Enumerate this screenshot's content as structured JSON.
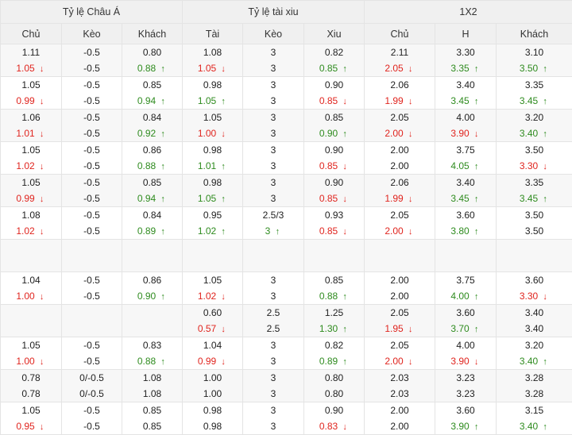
{
  "header": {
    "groups": [
      "Tỷ lệ Châu Á",
      "Tỷ lệ tài xiu",
      "1X2"
    ],
    "columns": [
      "Chủ",
      "Kèo",
      "Khách",
      "Tài",
      "Kèo",
      "Xiu",
      "Chủ",
      "H",
      "Khách"
    ]
  },
  "colors": {
    "up": "#2e8b1e",
    "down": "#e0241e",
    "header_bg": "#f0f0f0",
    "alt_bg": "#f7f7f7"
  },
  "rows": [
    [
      [
        {
          "v": "1.11"
        },
        {
          "v": "1.05",
          "d": "down"
        }
      ],
      [
        {
          "v": "-0.5"
        },
        {
          "v": "-0.5"
        }
      ],
      [
        {
          "v": "0.80"
        },
        {
          "v": "0.88",
          "d": "up"
        }
      ],
      [
        {
          "v": "1.08"
        },
        {
          "v": "1.05",
          "d": "down"
        }
      ],
      [
        {
          "v": "3"
        },
        {
          "v": "3"
        }
      ],
      [
        {
          "v": "0.82"
        },
        {
          "v": "0.85",
          "d": "up"
        }
      ],
      [
        {
          "v": "2.11"
        },
        {
          "v": "2.05",
          "d": "down"
        }
      ],
      [
        {
          "v": "3.30"
        },
        {
          "v": "3.35",
          "d": "up"
        }
      ],
      [
        {
          "v": "3.10"
        },
        {
          "v": "3.50",
          "d": "up"
        }
      ]
    ],
    [
      [
        {
          "v": "1.05"
        },
        {
          "v": "0.99",
          "d": "down"
        }
      ],
      [
        {
          "v": "-0.5"
        },
        {
          "v": "-0.5"
        }
      ],
      [
        {
          "v": "0.85"
        },
        {
          "v": "0.94",
          "d": "up"
        }
      ],
      [
        {
          "v": "0.98"
        },
        {
          "v": "1.05",
          "d": "up"
        }
      ],
      [
        {
          "v": "3"
        },
        {
          "v": "3"
        }
      ],
      [
        {
          "v": "0.90"
        },
        {
          "v": "0.85",
          "d": "down"
        }
      ],
      [
        {
          "v": "2.06"
        },
        {
          "v": "1.99",
          "d": "down"
        }
      ],
      [
        {
          "v": "3.40"
        },
        {
          "v": "3.45",
          "d": "up"
        }
      ],
      [
        {
          "v": "3.35"
        },
        {
          "v": "3.45",
          "d": "up"
        }
      ]
    ],
    [
      [
        {
          "v": "1.06"
        },
        {
          "v": "1.01",
          "d": "down"
        }
      ],
      [
        {
          "v": "-0.5"
        },
        {
          "v": "-0.5"
        }
      ],
      [
        {
          "v": "0.84"
        },
        {
          "v": "0.92",
          "d": "up"
        }
      ],
      [
        {
          "v": "1.05"
        },
        {
          "v": "1.00",
          "d": "down"
        }
      ],
      [
        {
          "v": "3"
        },
        {
          "v": "3"
        }
      ],
      [
        {
          "v": "0.85"
        },
        {
          "v": "0.90",
          "d": "up"
        }
      ],
      [
        {
          "v": "2.05"
        },
        {
          "v": "2.00",
          "d": "down"
        }
      ],
      [
        {
          "v": "4.00"
        },
        {
          "v": "3.90",
          "d": "down"
        }
      ],
      [
        {
          "v": "3.20"
        },
        {
          "v": "3.40",
          "d": "up"
        }
      ]
    ],
    [
      [
        {
          "v": "1.05"
        },
        {
          "v": "1.02",
          "d": "down"
        }
      ],
      [
        {
          "v": "-0.5"
        },
        {
          "v": "-0.5"
        }
      ],
      [
        {
          "v": "0.86"
        },
        {
          "v": "0.88",
          "d": "up"
        }
      ],
      [
        {
          "v": "0.98"
        },
        {
          "v": "1.01",
          "d": "up"
        }
      ],
      [
        {
          "v": "3"
        },
        {
          "v": "3"
        }
      ],
      [
        {
          "v": "0.90"
        },
        {
          "v": "0.85",
          "d": "down"
        }
      ],
      [
        {
          "v": "2.00"
        },
        {
          "v": "2.00"
        }
      ],
      [
        {
          "v": "3.75"
        },
        {
          "v": "4.05",
          "d": "up"
        }
      ],
      [
        {
          "v": "3.50"
        },
        {
          "v": "3.30",
          "d": "down"
        }
      ]
    ],
    [
      [
        {
          "v": "1.05"
        },
        {
          "v": "0.99",
          "d": "down"
        }
      ],
      [
        {
          "v": "-0.5"
        },
        {
          "v": "-0.5"
        }
      ],
      [
        {
          "v": "0.85"
        },
        {
          "v": "0.94",
          "d": "up"
        }
      ],
      [
        {
          "v": "0.98"
        },
        {
          "v": "1.05",
          "d": "up"
        }
      ],
      [
        {
          "v": "3"
        },
        {
          "v": "3"
        }
      ],
      [
        {
          "v": "0.90"
        },
        {
          "v": "0.85",
          "d": "down"
        }
      ],
      [
        {
          "v": "2.06"
        },
        {
          "v": "1.99",
          "d": "down"
        }
      ],
      [
        {
          "v": "3.40"
        },
        {
          "v": "3.45",
          "d": "up"
        }
      ],
      [
        {
          "v": "3.35"
        },
        {
          "v": "3.45",
          "d": "up"
        }
      ]
    ],
    [
      [
        {
          "v": "1.08"
        },
        {
          "v": "1.02",
          "d": "down"
        }
      ],
      [
        {
          "v": "-0.5"
        },
        {
          "v": "-0.5"
        }
      ],
      [
        {
          "v": "0.84"
        },
        {
          "v": "0.89",
          "d": "up"
        }
      ],
      [
        {
          "v": "0.95"
        },
        {
          "v": "1.02",
          "d": "up"
        }
      ],
      [
        {
          "v": "2.5/3"
        },
        {
          "v": "3",
          "d": "up"
        }
      ],
      [
        {
          "v": "0.93"
        },
        {
          "v": "0.85",
          "d": "down"
        }
      ],
      [
        {
          "v": "2.05"
        },
        {
          "v": "2.00",
          "d": "down"
        }
      ],
      [
        {
          "v": "3.60"
        },
        {
          "v": "3.80",
          "d": "up"
        }
      ],
      [
        {
          "v": "3.50"
        },
        {
          "v": "3.50"
        }
      ]
    ],
    [
      [],
      [],
      [],
      [],
      [],
      [],
      [],
      [],
      []
    ],
    [
      [
        {
          "v": "1.04"
        },
        {
          "v": "1.00",
          "d": "down"
        }
      ],
      [
        {
          "v": "-0.5"
        },
        {
          "v": "-0.5"
        }
      ],
      [
        {
          "v": "0.86"
        },
        {
          "v": "0.90",
          "d": "up"
        }
      ],
      [
        {
          "v": "1.05"
        },
        {
          "v": "1.02",
          "d": "down"
        }
      ],
      [
        {
          "v": "3"
        },
        {
          "v": "3"
        }
      ],
      [
        {
          "v": "0.85"
        },
        {
          "v": "0.88",
          "d": "up"
        }
      ],
      [
        {
          "v": "2.00"
        },
        {
          "v": "2.00"
        }
      ],
      [
        {
          "v": "3.75"
        },
        {
          "v": "4.00",
          "d": "up"
        }
      ],
      [
        {
          "v": "3.60"
        },
        {
          "v": "3.30",
          "d": "down"
        }
      ]
    ],
    [
      [],
      [],
      [],
      [
        {
          "v": "0.60"
        },
        {
          "v": "0.57",
          "d": "down"
        }
      ],
      [
        {
          "v": "2.5"
        },
        {
          "v": "2.5"
        }
      ],
      [
        {
          "v": "1.25"
        },
        {
          "v": "1.30",
          "d": "up"
        }
      ],
      [
        {
          "v": "2.05"
        },
        {
          "v": "1.95",
          "d": "down"
        }
      ],
      [
        {
          "v": "3.60"
        },
        {
          "v": "3.70",
          "d": "up"
        }
      ],
      [
        {
          "v": "3.40"
        },
        {
          "v": "3.40"
        }
      ]
    ],
    [
      [
        {
          "v": "1.05"
        },
        {
          "v": "1.00",
          "d": "down"
        }
      ],
      [
        {
          "v": "-0.5"
        },
        {
          "v": "-0.5"
        }
      ],
      [
        {
          "v": "0.83"
        },
        {
          "v": "0.88",
          "d": "up"
        }
      ],
      [
        {
          "v": "1.04"
        },
        {
          "v": "0.99",
          "d": "down"
        }
      ],
      [
        {
          "v": "3"
        },
        {
          "v": "3"
        }
      ],
      [
        {
          "v": "0.82"
        },
        {
          "v": "0.89",
          "d": "up"
        }
      ],
      [
        {
          "v": "2.05"
        },
        {
          "v": "2.00",
          "d": "down"
        }
      ],
      [
        {
          "v": "4.00"
        },
        {
          "v": "3.90",
          "d": "down"
        }
      ],
      [
        {
          "v": "3.20"
        },
        {
          "v": "3.40",
          "d": "up"
        }
      ]
    ],
    [
      [
        {
          "v": "0.78"
        },
        {
          "v": "0.78"
        }
      ],
      [
        {
          "v": "0/-0.5"
        },
        {
          "v": "0/-0.5"
        }
      ],
      [
        {
          "v": "1.08"
        },
        {
          "v": "1.08"
        }
      ],
      [
        {
          "v": "1.00"
        },
        {
          "v": "1.00"
        }
      ],
      [
        {
          "v": "3"
        },
        {
          "v": "3"
        }
      ],
      [
        {
          "v": "0.80"
        },
        {
          "v": "0.80"
        }
      ],
      [
        {
          "v": "2.03"
        },
        {
          "v": "2.03"
        }
      ],
      [
        {
          "v": "3.23"
        },
        {
          "v": "3.23"
        }
      ],
      [
        {
          "v": "3.28"
        },
        {
          "v": "3.28"
        }
      ]
    ],
    [
      [
        {
          "v": "1.05"
        },
        {
          "v": "0.95",
          "d": "down"
        }
      ],
      [
        {
          "v": "-0.5"
        },
        {
          "v": "-0.5"
        }
      ],
      [
        {
          "v": "0.85"
        },
        {
          "v": "0.85"
        }
      ],
      [
        {
          "v": "0.98"
        },
        {
          "v": "0.98"
        }
      ],
      [
        {
          "v": "3"
        },
        {
          "v": "3"
        }
      ],
      [
        {
          "v": "0.90"
        },
        {
          "v": "0.83",
          "d": "down"
        }
      ],
      [
        {
          "v": "2.00"
        },
        {
          "v": "2.00"
        }
      ],
      [
        {
          "v": "3.60"
        },
        {
          "v": "3.90",
          "d": "up"
        }
      ],
      [
        {
          "v": "3.15"
        },
        {
          "v": "3.40",
          "d": "up"
        }
      ]
    ]
  ]
}
